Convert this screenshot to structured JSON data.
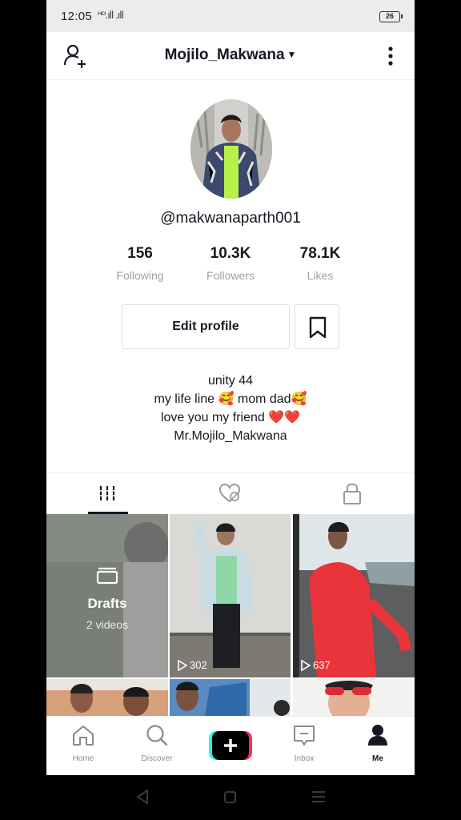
{
  "status_bar": {
    "time": "12:05",
    "signal": "ᴴᴰ.ıll .ıll",
    "battery": "26"
  },
  "header": {
    "username": "Mojilo_Makwana",
    "add_user_icon": "person-add-icon",
    "more_icon": "more-vertical-icon"
  },
  "profile": {
    "handle": "@makwanaparth001",
    "stats": [
      {
        "value": "156",
        "label": "Following"
      },
      {
        "value": "10.3K",
        "label": "Followers"
      },
      {
        "value": "78.1K",
        "label": "Likes"
      }
    ],
    "edit_button": "Edit profile",
    "bio": [
      "unity 44",
      "my life line 🥰 mom dad🥰",
      "love you my friend ❤️❤️",
      "Mr.Mojilo_Makwana"
    ]
  },
  "tabs": [
    {
      "name": "videos",
      "icon": "grid-bars-icon",
      "active": true
    },
    {
      "name": "liked",
      "icon": "heart-hidden-icon",
      "active": false
    },
    {
      "name": "private",
      "icon": "lock-icon",
      "active": false
    }
  ],
  "grid": {
    "drafts": {
      "title": "Drafts",
      "subtitle": "2 videos"
    },
    "videos": [
      {
        "views": "302"
      },
      {
        "views": "637"
      }
    ]
  },
  "bottom_nav": [
    {
      "label": "Home",
      "icon": "home-icon"
    },
    {
      "label": "Discover",
      "icon": "search-icon"
    },
    {
      "label": "",
      "icon": "plus-icon"
    },
    {
      "label": "Inbox",
      "icon": "inbox-icon"
    },
    {
      "label": "Me",
      "icon": "person-icon",
      "active": true
    }
  ],
  "colors": {
    "accent_cyan": "#25f4ee",
    "accent_red": "#fe2c55",
    "text": "#161823",
    "muted": "#a0a0a6"
  }
}
